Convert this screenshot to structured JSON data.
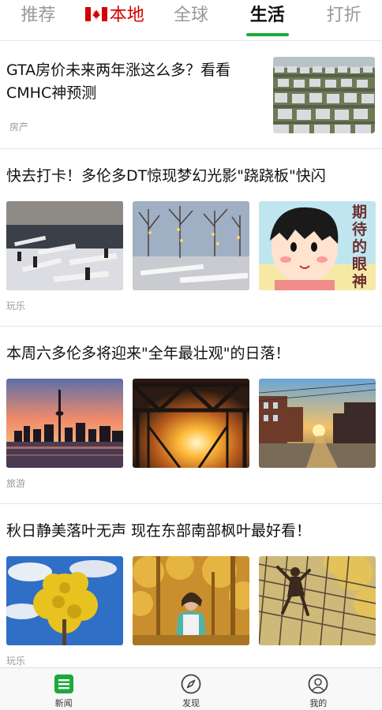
{
  "tabs": [
    {
      "label": "推荐"
    },
    {
      "label": "本地"
    },
    {
      "label": "全球"
    },
    {
      "label": "生活"
    },
    {
      "label": "打折"
    }
  ],
  "active_tab": "生活",
  "colors": {
    "accent": "#1aab3b",
    "local": "#d40000"
  },
  "articles": [
    {
      "title": "GTA房价未来两年涨这么多？看看CMHC神预测",
      "tag": "房产"
    },
    {
      "title": "快去打卡！多伦多DT惊现梦幻光影\"跷跷板\"快闪",
      "tag": "玩乐",
      "thumb_text": "期待的眼神"
    },
    {
      "title": "本周六多伦多将迎来\"全年最壮观\"的日落！",
      "tag": "旅游"
    },
    {
      "title": "秋日静美落叶无声 现在东部南部枫叶最好看！",
      "tag": "玩乐"
    }
  ],
  "bottom_nav": [
    {
      "label": "新闻",
      "icon": "news-icon"
    },
    {
      "label": "发现",
      "icon": "compass-icon"
    },
    {
      "label": "我的",
      "icon": "user-icon"
    }
  ]
}
